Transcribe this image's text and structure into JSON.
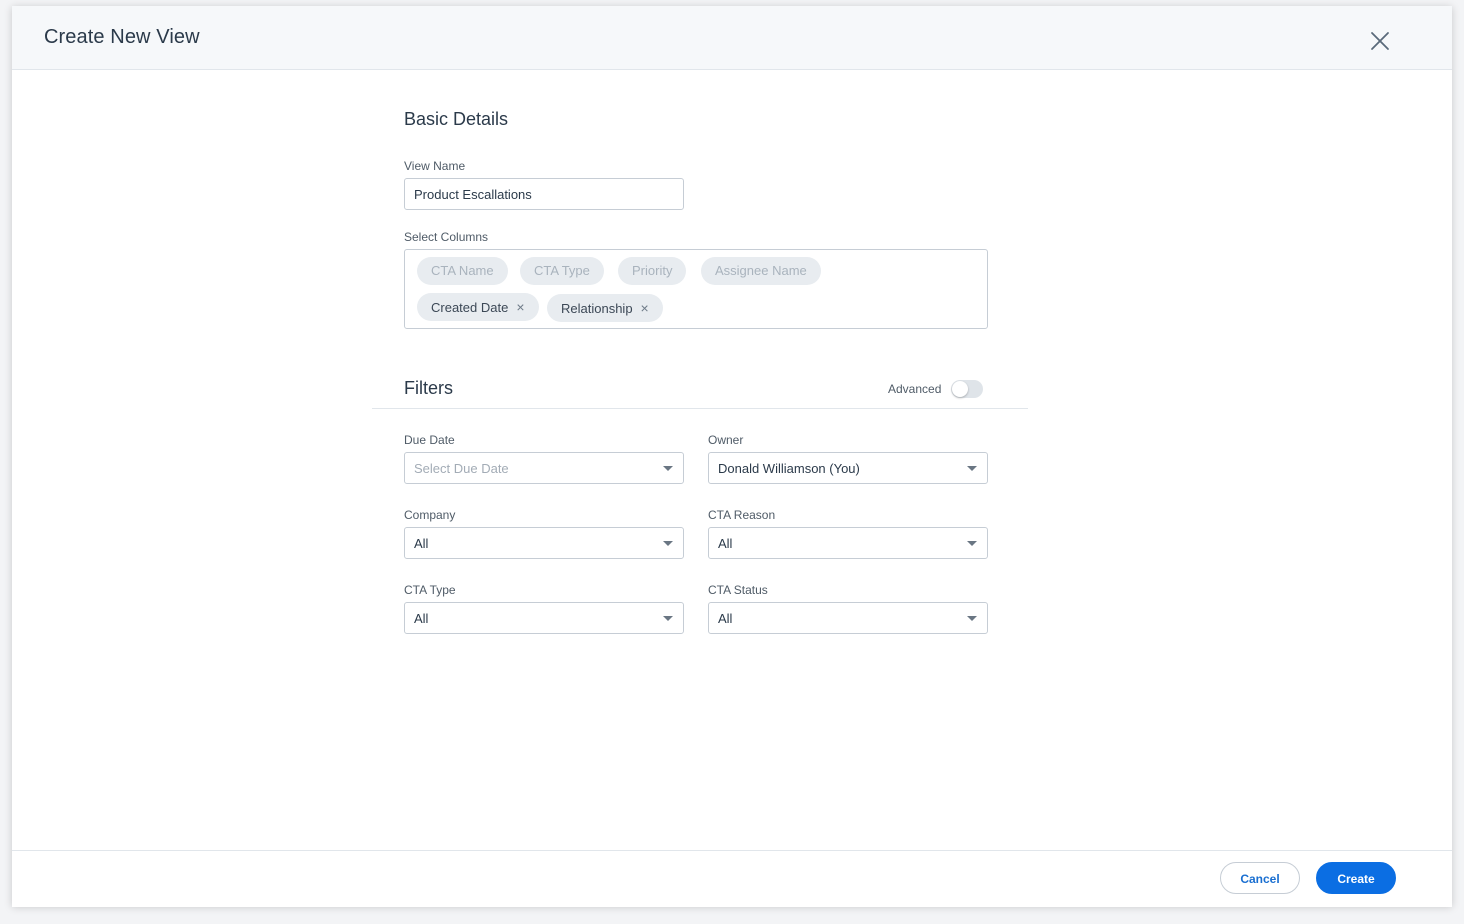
{
  "modal": {
    "title": "Create New View",
    "close_icon": "close-icon"
  },
  "basic_details": {
    "title": "Basic Details",
    "view_name_label": "View Name",
    "view_name_value": "Product Escallations",
    "select_columns_label": "Select Columns",
    "chips": [
      {
        "label": "CTA Name",
        "selected": false
      },
      {
        "label": "CTA Type",
        "selected": false
      },
      {
        "label": "Priority",
        "selected": false
      },
      {
        "label": "Assignee Name",
        "selected": false
      },
      {
        "label": "Created Date",
        "selected": true,
        "remove": "×"
      },
      {
        "label": "Relationship",
        "selected": true,
        "remove": "×"
      }
    ]
  },
  "filters": {
    "title": "Filters",
    "advanced_label": "Advanced",
    "advanced_enabled": false,
    "due_date": {
      "label": "Due Date",
      "placeholder": "Select Due Date"
    },
    "owner": {
      "label": "Owner",
      "value": "Donald Williamson (You)"
    },
    "company": {
      "label": "Company",
      "value": "All"
    },
    "cta_reason": {
      "label": "CTA Reason",
      "value": "All"
    },
    "cta_type": {
      "label": "CTA Type",
      "value": "All"
    },
    "cta_status": {
      "label": "CTA Status",
      "value": "All"
    }
  },
  "footer": {
    "cancel_label": "Cancel",
    "create_label": "Create"
  },
  "colors": {
    "primary": "#0b6ee3",
    "header_bg": "#f6f8fa",
    "chip_bg": "#e8ecf0"
  }
}
